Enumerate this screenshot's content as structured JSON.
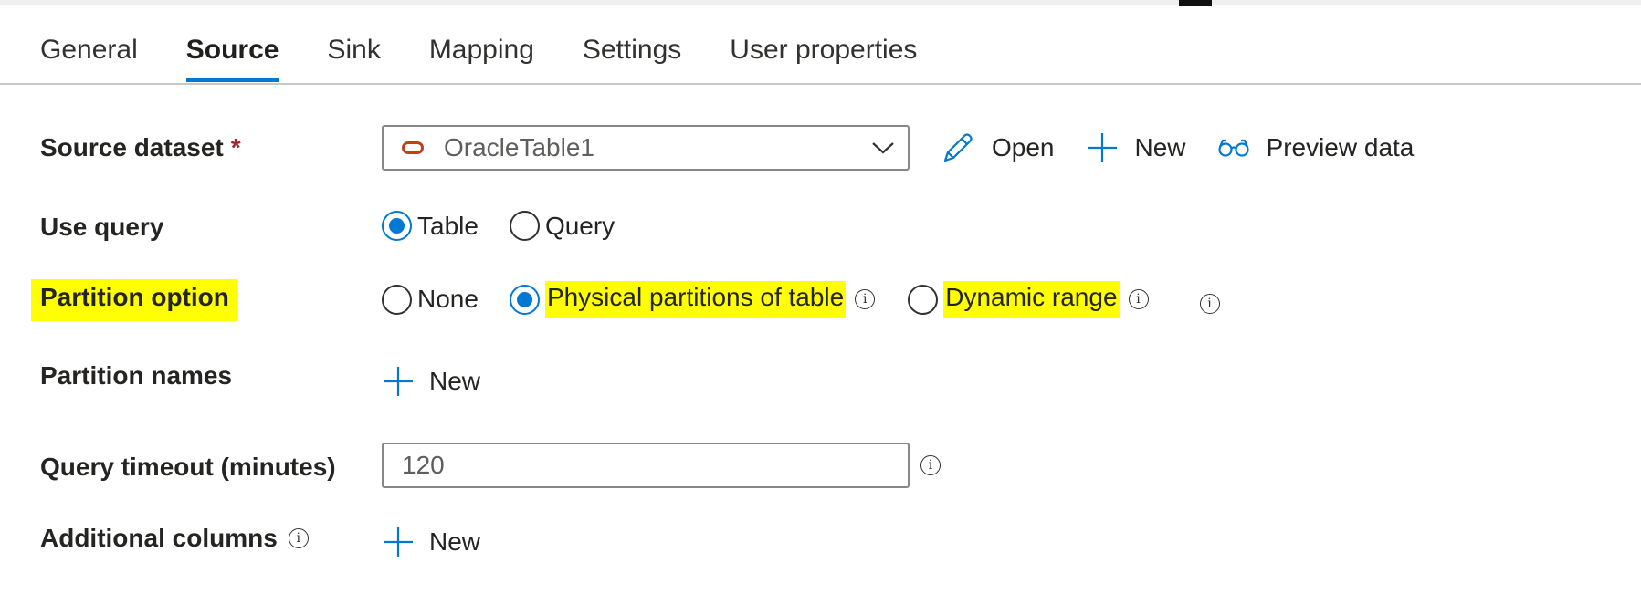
{
  "tabs": [
    {
      "label": "General",
      "active": false
    },
    {
      "label": "Source",
      "active": true
    },
    {
      "label": "Sink",
      "active": false
    },
    {
      "label": "Mapping",
      "active": false
    },
    {
      "label": "Settings",
      "active": false
    },
    {
      "label": "User properties",
      "active": false
    }
  ],
  "source_dataset": {
    "label": "Source dataset",
    "required_marker": "*",
    "value": "OracleTable1",
    "icon": "oracle-dataset-icon",
    "actions": {
      "open": {
        "label": "Open",
        "icon": "pencil-icon"
      },
      "new": {
        "label": "New",
        "icon": "plus-icon"
      },
      "preview": {
        "label": "Preview data",
        "icon": "glasses-icon"
      }
    }
  },
  "use_query": {
    "label": "Use query",
    "options": [
      {
        "label": "Table",
        "checked": true
      },
      {
        "label": "Query",
        "checked": false
      }
    ]
  },
  "partition_option": {
    "label": "Partition option",
    "options": [
      {
        "label": "None",
        "checked": false
      },
      {
        "label": "Physical partitions of table",
        "checked": true
      },
      {
        "label": "Dynamic range",
        "checked": false
      }
    ]
  },
  "partition_names": {
    "label": "Partition names",
    "new_label": "New"
  },
  "query_timeout": {
    "label": "Query timeout (minutes)",
    "value": "120"
  },
  "additional_columns": {
    "label": "Additional columns",
    "new_label": "New"
  },
  "colors": {
    "accent": "#0078d4",
    "highlight": "#ffff00",
    "required": "#a4262c",
    "oracle": "#c43e1c"
  }
}
